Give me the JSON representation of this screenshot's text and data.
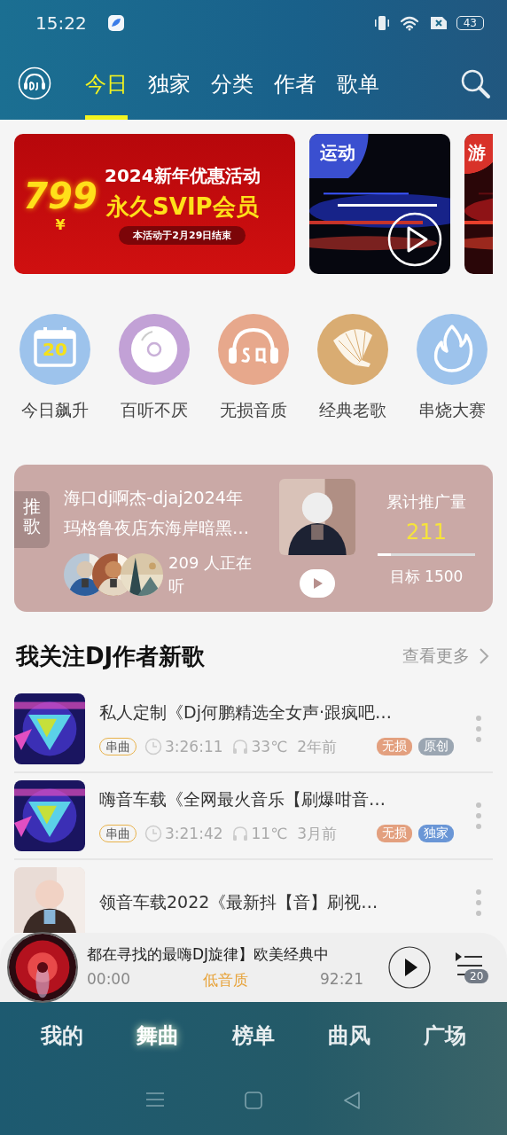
{
  "status_bar": {
    "time": "15:22",
    "battery": "43"
  },
  "top_tabs": [
    {
      "label": "今日",
      "selected": true
    },
    {
      "label": "独家",
      "selected": false
    },
    {
      "label": "分类",
      "selected": false
    },
    {
      "label": "作者",
      "selected": false
    },
    {
      "label": "歌单",
      "selected": false
    }
  ],
  "banners": [
    {
      "kind": "promo",
      "price": "799",
      "currency": "¥",
      "headline": "2024新年优惠活动",
      "subhead": "永久SVIP会员",
      "note": "本活动于2月29日结束"
    },
    {
      "kind": "video",
      "tag": "运动",
      "color": "#3a4fd0"
    },
    {
      "kind": "video",
      "tag": "游",
      "color": "#d8322a"
    }
  ],
  "shortcuts": [
    {
      "kind": "calendar",
      "day": "20",
      "label": "今日飙升",
      "color": "#9dc3ec"
    },
    {
      "kind": "disc",
      "label": "百听不厌",
      "color": "#c2a1d6"
    },
    {
      "kind": "sq",
      "label": "无损音质",
      "color": "#e7a88c"
    },
    {
      "kind": "gramophone",
      "label": "经典老歌",
      "color": "#d9ac72"
    },
    {
      "kind": "flame",
      "label": "串烧大赛",
      "color": "#9dc3ec"
    }
  ],
  "featured": {
    "badge": "推歌",
    "title_lines": [
      "海口dj啊杰-djaj2024年",
      "玛格鲁夜店东海岸暗黑…"
    ],
    "listeners": "209 人正在听",
    "stat_label": "累计推广量",
    "stat_value": "211",
    "level": 0.14,
    "target": "目标 1500"
  },
  "section": {
    "title": "我关注DJ作者新歌",
    "more": "查看更多"
  },
  "songs": [
    {
      "title": "私人定制《Dj何鹏精选全女声·跟疯吧…",
      "tag": "串曲",
      "duration": "3:26:11",
      "heat": "33℃",
      "age": "2年前",
      "badges": [
        {
          "label": "无损",
          "color": "#e3a07f"
        },
        {
          "label": "原创",
          "color": "#9ba6b2"
        }
      ]
    },
    {
      "title": "嗨音车载《全网最火音乐【刷爆咁音…",
      "tag": "串曲",
      "duration": "3:21:42",
      "heat": "11℃",
      "age": "3月前",
      "badges": [
        {
          "label": "无损",
          "color": "#e3a07f"
        },
        {
          "label": "独家",
          "color": "#6a96d6"
        }
      ]
    },
    {
      "title": "领音车载2022《最新抖【音】刷视…"
    }
  ],
  "player": {
    "title": "都在寻找的最嗨DJ旋律】欧美经典中",
    "elapsed": "00:00",
    "quality": "低音质",
    "total": "92:21",
    "queue_count": "20"
  },
  "bottom_nav": [
    {
      "label": "我的",
      "selected": false
    },
    {
      "label": "舞曲",
      "selected": true
    },
    {
      "label": "榜单",
      "selected": false
    },
    {
      "label": "曲风",
      "selected": false
    },
    {
      "label": "广场",
      "selected": false
    }
  ]
}
